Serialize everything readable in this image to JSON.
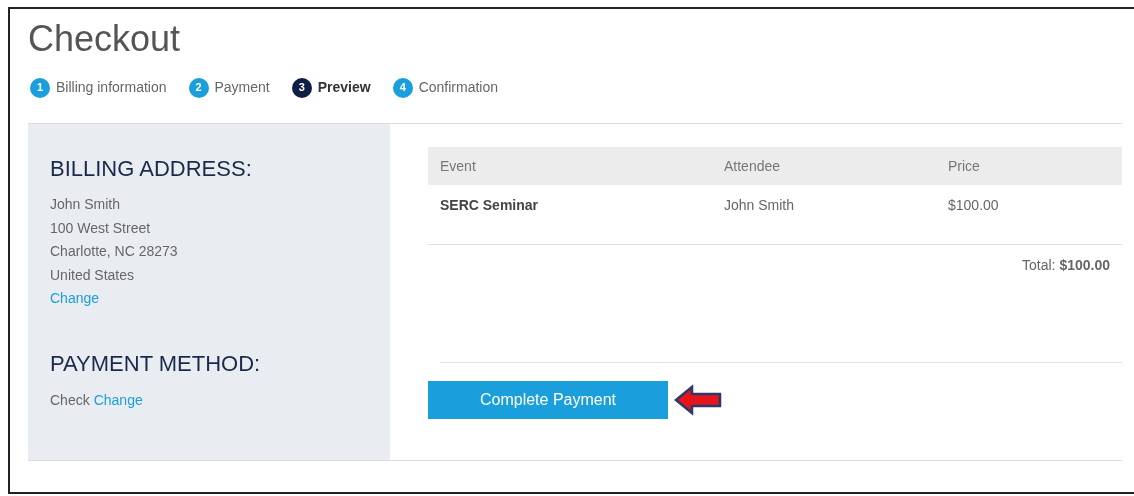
{
  "title": "Checkout",
  "steps": [
    {
      "number": "1",
      "label": "Billing information",
      "selected": false
    },
    {
      "number": "2",
      "label": "Payment",
      "selected": false
    },
    {
      "number": "3",
      "label": "Preview",
      "selected": true
    },
    {
      "number": "4",
      "label": "Confirmation",
      "selected": false
    }
  ],
  "billing_address": {
    "heading": "BILLING ADDRESS:",
    "lines": [
      "John Smith",
      "100 West Street",
      "Charlotte, NC 28273",
      "United States"
    ],
    "change_link": "Change"
  },
  "payment_method": {
    "heading": "PAYMENT METHOD:",
    "value": "Check",
    "change_link": "Change"
  },
  "table": {
    "columns": [
      "Event",
      "Attendee",
      "Price"
    ],
    "rows": [
      [
        "SERC Seminar",
        "John Smith",
        "$100.00"
      ]
    ],
    "total": "Total: **$100.00**"
  },
  "button": "Complete Payment"
}
